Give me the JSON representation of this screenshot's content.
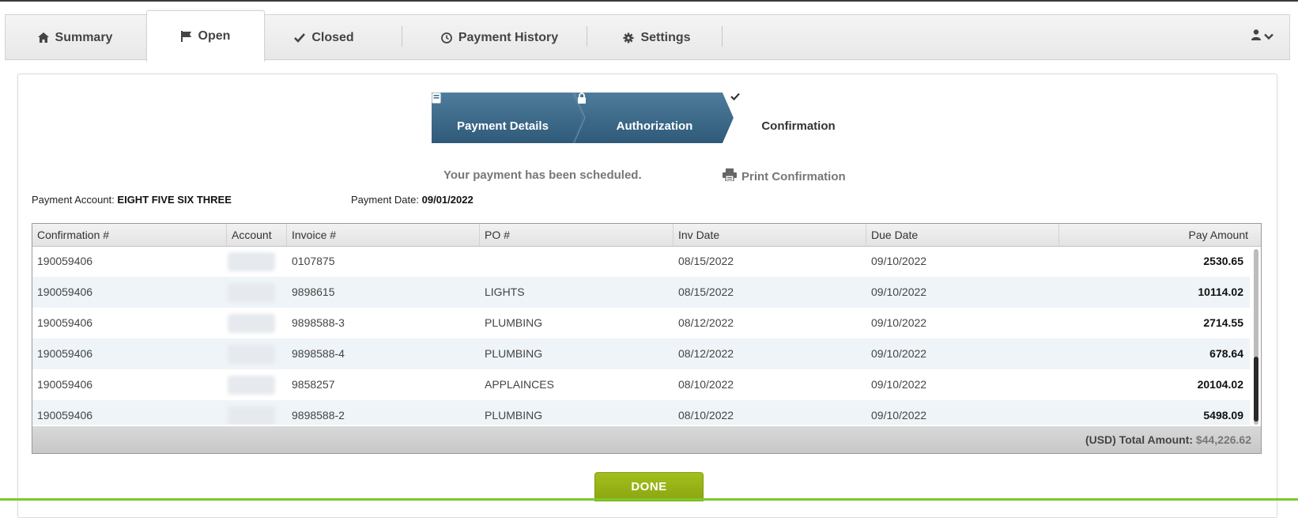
{
  "tabs": [
    {
      "label": "Summary",
      "icon": "home-icon"
    },
    {
      "label": "Open",
      "icon": "flag-icon"
    },
    {
      "label": "Closed",
      "icon": "check-icon"
    },
    {
      "label": "Payment History",
      "icon": "clock-icon"
    },
    {
      "label": "Settings",
      "icon": "gear-icon"
    }
  ],
  "active_tab": "Open",
  "stepper": {
    "steps": [
      {
        "label": "Payment Details",
        "icon": "document-icon"
      },
      {
        "label": "Authorization",
        "icon": "lock-icon"
      },
      {
        "label": "Confirmation",
        "icon": "check-icon"
      }
    ],
    "current": "Confirmation"
  },
  "status_message": "Your payment has been scheduled.",
  "print_label": "Print Confirmation",
  "payment_account_label": "Payment Account:",
  "payment_account_value": "EIGHT FIVE SIX THREE",
  "payment_date_label": "Payment Date:",
  "payment_date_value": "09/01/2022",
  "table": {
    "columns": [
      "Confirmation #",
      "Account",
      "Invoice #",
      "PO #",
      "Inv Date",
      "Due Date",
      "Pay Amount"
    ],
    "rows": [
      {
        "confirmation": "190059406",
        "invoice": "0107875",
        "po": "",
        "inv_date": "08/15/2022",
        "due_date": "09/10/2022",
        "amount": "2530.65"
      },
      {
        "confirmation": "190059406",
        "invoice": "9898615",
        "po": "LIGHTS",
        "inv_date": "08/15/2022",
        "due_date": "09/10/2022",
        "amount": "10114.02"
      },
      {
        "confirmation": "190059406",
        "invoice": "9898588-3",
        "po": "PLUMBING",
        "inv_date": "08/12/2022",
        "due_date": "09/10/2022",
        "amount": "2714.55"
      },
      {
        "confirmation": "190059406",
        "invoice": "9898588-4",
        "po": "PLUMBING",
        "inv_date": "08/12/2022",
        "due_date": "09/10/2022",
        "amount": "678.64"
      },
      {
        "confirmation": "190059406",
        "invoice": "9858257",
        "po": "APPLAINCES",
        "inv_date": "08/10/2022",
        "due_date": "09/10/2022",
        "amount": "20104.02"
      },
      {
        "confirmation": "190059406",
        "invoice": "9898588-2",
        "po": "PLUMBING",
        "inv_date": "08/10/2022",
        "due_date": "09/10/2022",
        "amount": "5498.09"
      }
    ],
    "total_label": "(USD) Total Amount:",
    "total_value": "$44,226.62"
  },
  "done_label": "DONE",
  "colors": {
    "step_active": "#3d6a8a",
    "done_button": "#94b216",
    "alt_row": "#eef4f8"
  }
}
